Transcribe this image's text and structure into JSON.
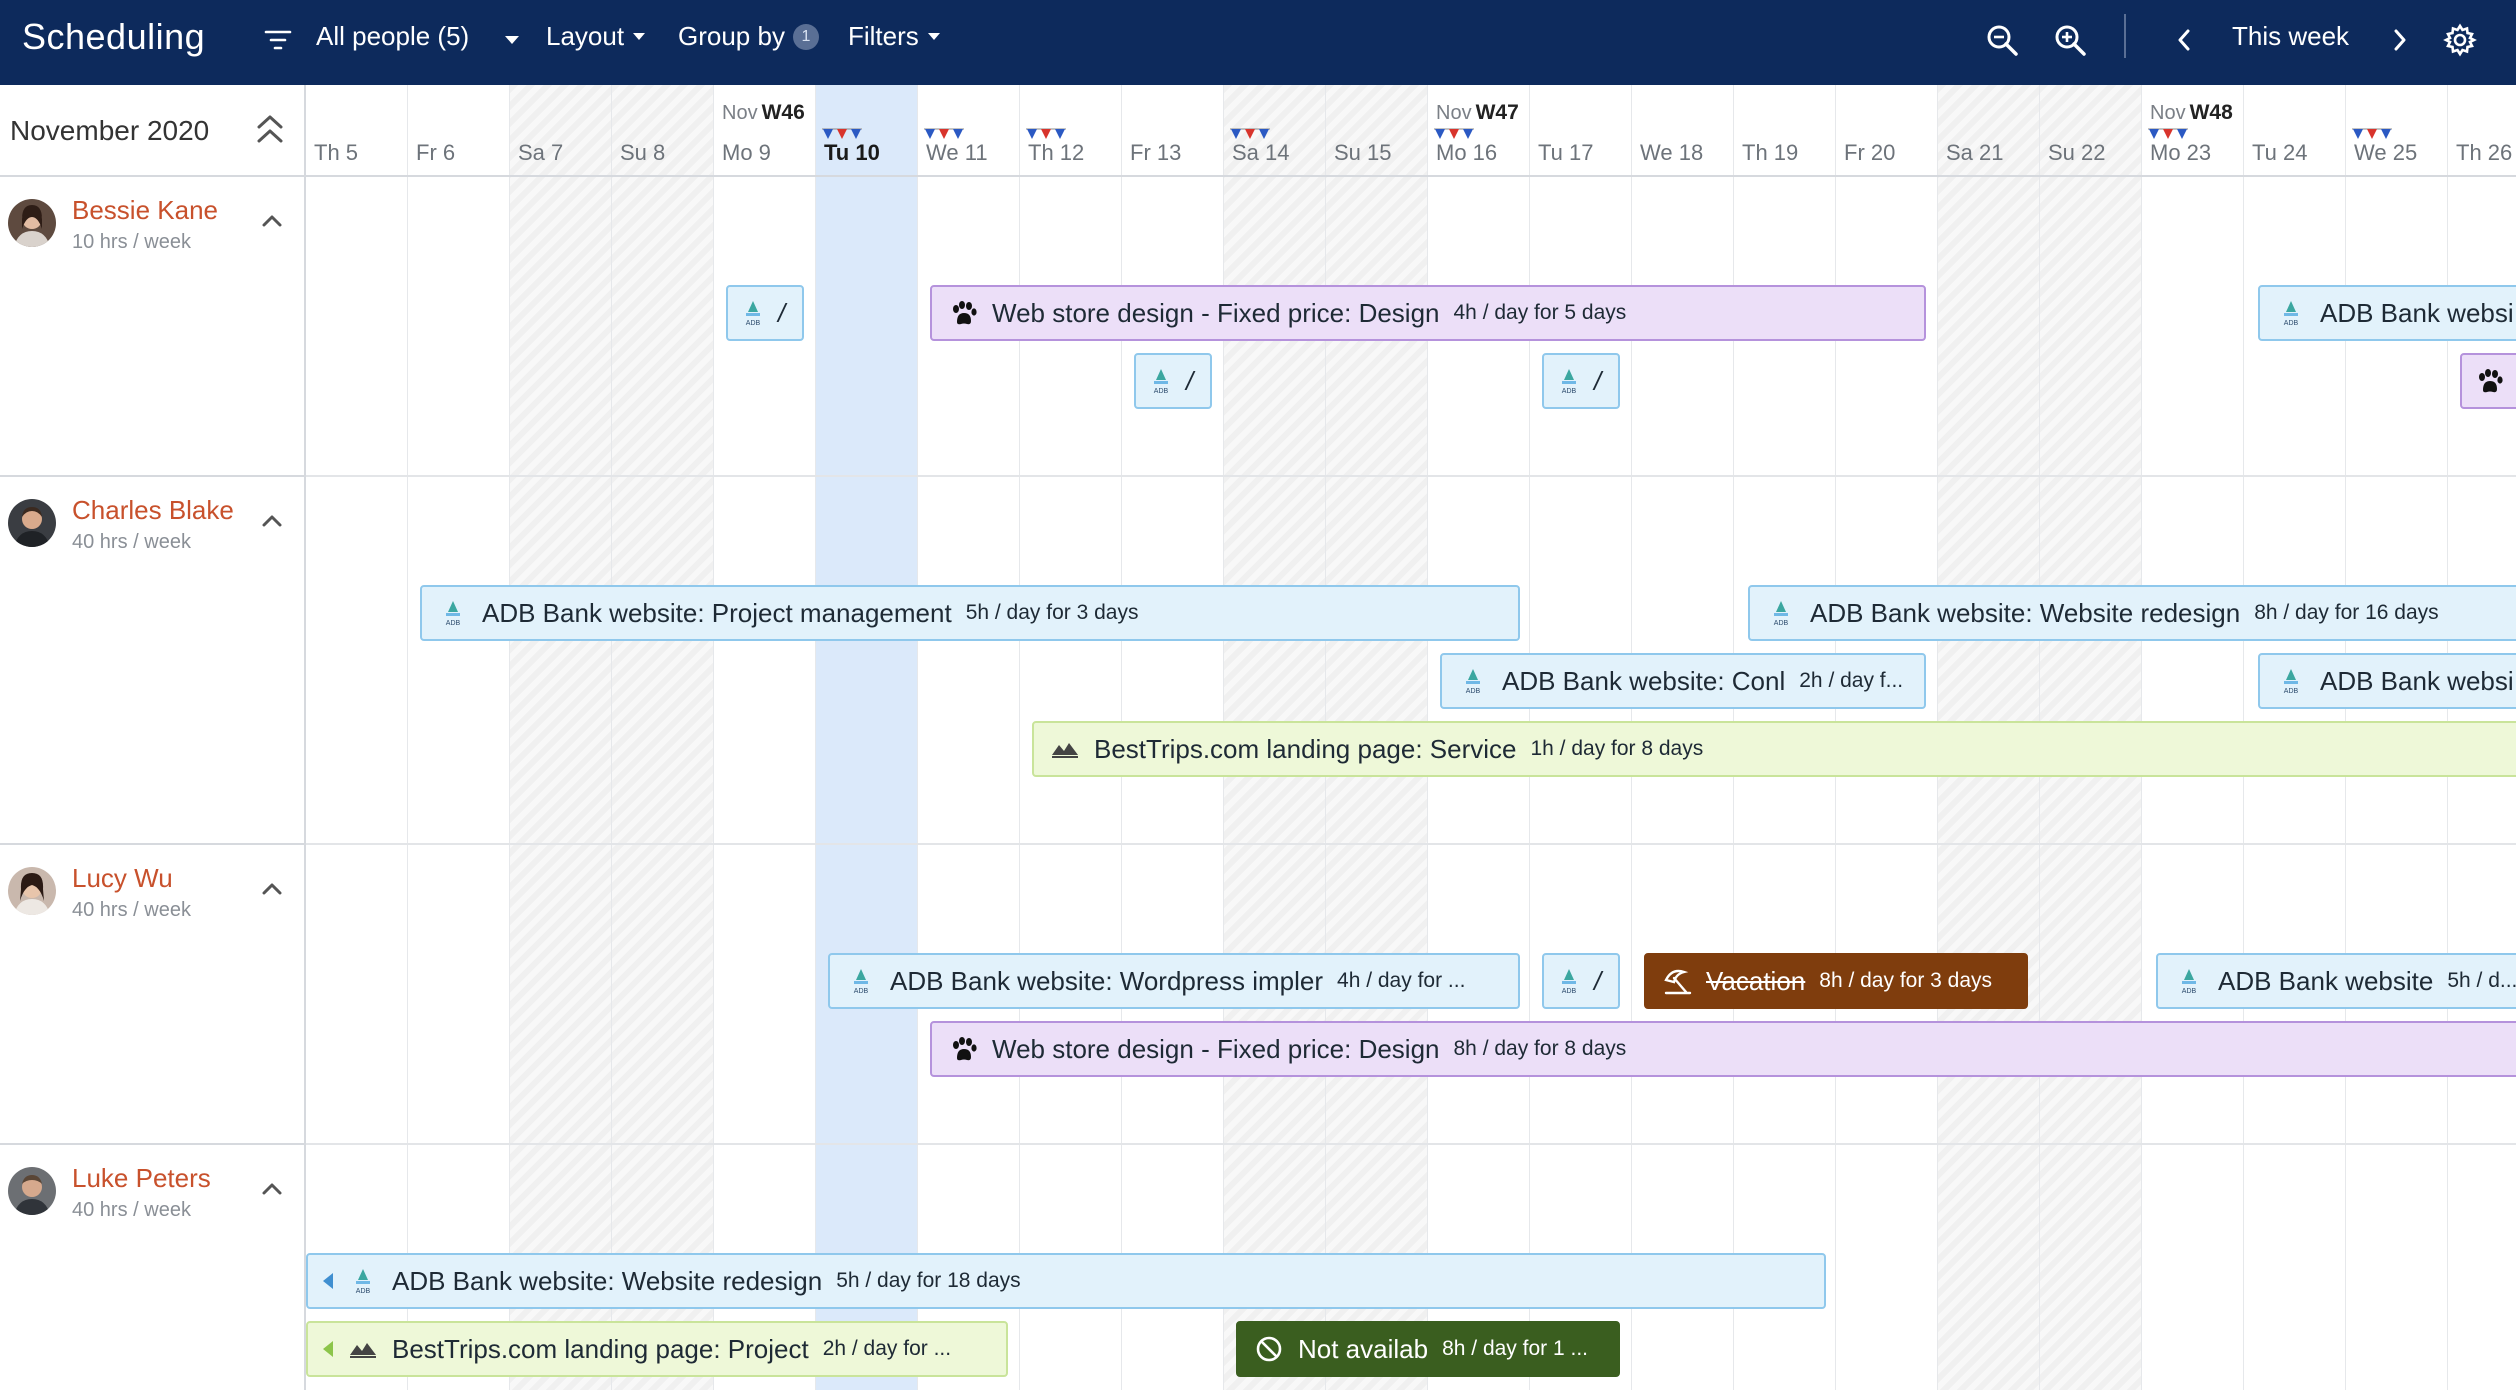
{
  "topbar": {
    "title": "Scheduling",
    "people_filter": "All people (5)",
    "layout_label": "Layout",
    "groupby_label": "Group by",
    "groupby_badge": "1",
    "filters_label": "Filters",
    "this_week_label": "This week"
  },
  "left": {
    "month_label": "November 2020",
    "people": [
      {
        "name": "Bessie Kane",
        "hours": "10 hrs / week"
      },
      {
        "name": "Charles Blake",
        "hours": "40 hrs / week"
      },
      {
        "name": "Lucy Wu",
        "hours": "40 hrs / week"
      },
      {
        "name": "Luke Peters",
        "hours": "40 hrs / week"
      }
    ]
  },
  "calendar": {
    "days": [
      "Th 5",
      "Fr 6",
      "Sa 7",
      "Su 8",
      "Mo 9",
      "Tu 10",
      "We 11",
      "Th 12",
      "Fr 13",
      "Sa 14",
      "Su 15",
      "Mo 16",
      "Tu 17",
      "We 18",
      "Th 19",
      "Fr 20",
      "Sa 21",
      "Su 22",
      "Mo 23",
      "Tu 24",
      "We 25",
      "Th 26"
    ],
    "weeks": [
      {
        "month": "Nov",
        "week": "W46"
      },
      {
        "month": "Nov",
        "week": "W47"
      },
      {
        "month": "Nov",
        "week": "W48"
      }
    ]
  },
  "bars": {
    "b1_name": "/",
    "b2_name": "Web store design - Fixed price: Design",
    "b2_detail": "4h / day for 5 days",
    "b3_name": "ADB Bank websi",
    "b4_name": "/",
    "b5_name": "/",
    "c1_name": "ADB Bank website: Project management",
    "c1_detail": "5h / day for 3 days",
    "c2_name": "ADB Bank website: Website redesign",
    "c2_detail": "8h / day for 16 days",
    "c3_name": "ADB Bank website: Conl",
    "c3_detail": "2h / day f...",
    "c4_name": "ADB Bank websi",
    "c5_name": "BestTrips.com landing page: Service",
    "c5_detail": "1h / day for 8 days",
    "l1_name": "ADB Bank website: Wordpress impler",
    "l1_detail": "4h / day for ...",
    "l2_name": "/",
    "l3_name": "Vacation",
    "l3_detail": "8h / day for 3 days",
    "l4_name": "ADB Bank website",
    "l4_detail": "5h / d...",
    "l5_name": "Web store design - Fixed price: Design",
    "l5_detail": "8h / day for 8 days",
    "p1_name": "ADB Bank website: Website redesign",
    "p1_detail": "5h / day for 18 days",
    "p2_name": "BestTrips.com landing page: Project",
    "p2_detail": "2h / day for ...",
    "p3_name": "Not availab",
    "p3_detail": "8h / day for 1 ..."
  },
  "colors": {
    "topbar": "#0d2a5c",
    "person_name": "#c8512c",
    "today_column": "#dbe9fa",
    "adb_bar": "#e2f2fb",
    "webstore_bar": "#ecdff8",
    "besttrips_bar": "#eef8d8",
    "vacation_bar": "#7f3d0d",
    "not_available_bar": "#3a5e1f"
  },
  "icons": {
    "filter": "filter-lines-icon",
    "zoom_out": "zoom-out-icon",
    "zoom_in": "zoom-in-icon",
    "prev": "chevron-left-icon",
    "next": "chevron-right-icon",
    "settings": "gear-icon"
  }
}
